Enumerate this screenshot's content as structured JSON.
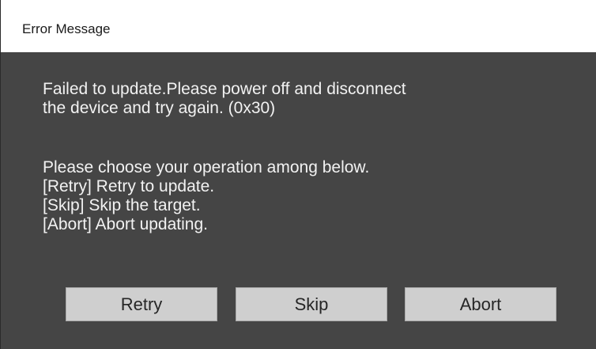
{
  "window": {
    "title": "Error Message"
  },
  "message": {
    "line1": "Failed to update.Please power off and disconnect",
    "line2": "the device and try again. (0x30)",
    "line3": "Please choose your operation among below.",
    "line4": "[Retry] Retry to update.",
    "line5": "[Skip] Skip the target.",
    "line6": "[Abort] Abort updating."
  },
  "buttons": {
    "retry_label": "Retry",
    "skip_label": "Skip",
    "abort_label": "Abort"
  },
  "colors": {
    "body_background": "#454545",
    "text": "#f2f2f2",
    "button_background": "#cfcfcf"
  }
}
